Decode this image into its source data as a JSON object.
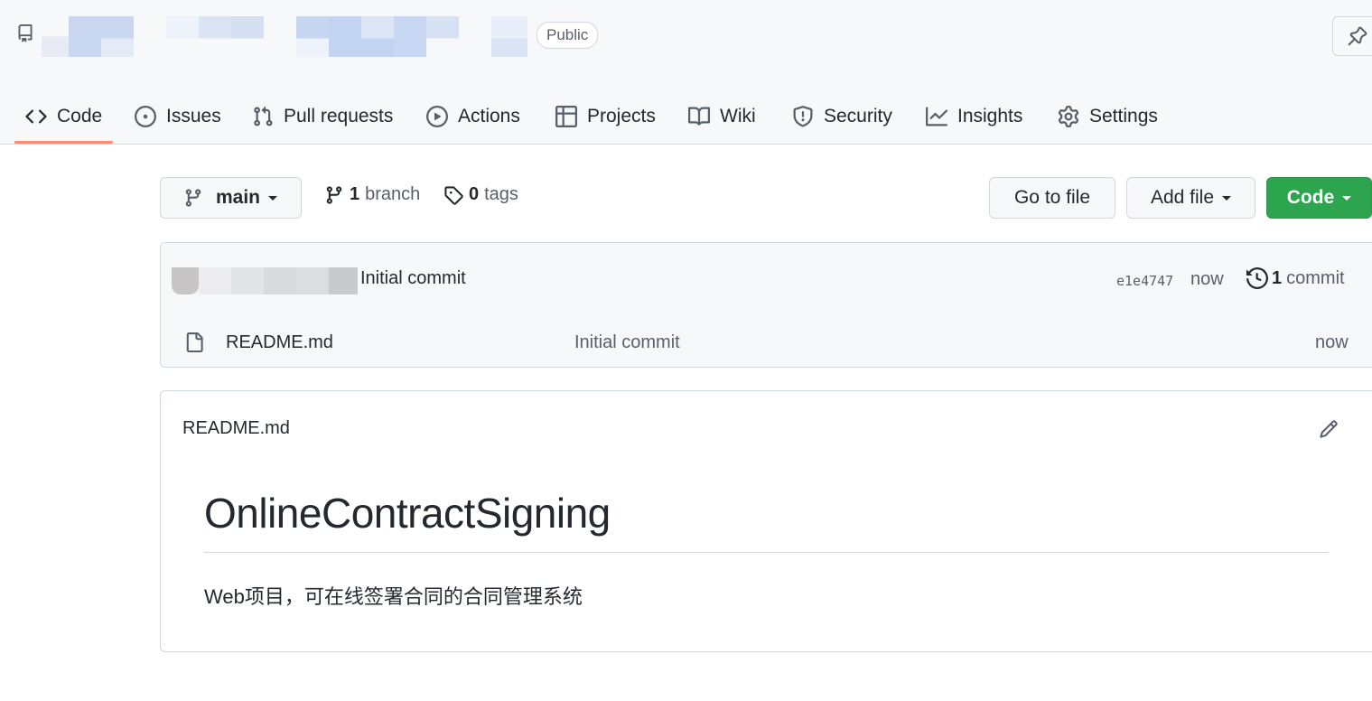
{
  "header": {
    "visibility_badge": "Public"
  },
  "nav": {
    "tabs": [
      {
        "label": "Code",
        "icon": "code-icon"
      },
      {
        "label": "Issues",
        "icon": "issue-opened-icon"
      },
      {
        "label": "Pull requests",
        "icon": "git-pull-request-icon"
      },
      {
        "label": "Actions",
        "icon": "play-icon"
      },
      {
        "label": "Projects",
        "icon": "table-icon"
      },
      {
        "label": "Wiki",
        "icon": "book-icon"
      },
      {
        "label": "Security",
        "icon": "shield-icon"
      },
      {
        "label": "Insights",
        "icon": "graph-icon"
      },
      {
        "label": "Settings",
        "icon": "gear-icon"
      }
    ],
    "active_tab": "Code",
    "accent_color": "#fd8c73"
  },
  "toolbar": {
    "branch_name": "main",
    "branch_count": "1",
    "branch_label": "branch",
    "tag_count": "0",
    "tag_label": "tags",
    "go_to_file": "Go to file",
    "add_file": "Add file",
    "code": "Code",
    "code_button_color": "#2da44e"
  },
  "latest_commit": {
    "message": "Initial commit",
    "sha": "e1e4747",
    "time": "now",
    "count": "1",
    "count_label": "commit"
  },
  "files": [
    {
      "name": "README.md",
      "commit_message": "Initial commit",
      "time": "now",
      "icon": "file-icon"
    }
  ],
  "readme": {
    "filename": "README.md",
    "heading": "OnlineContractSigning",
    "body": "Web项目，可在线签署合同的合同管理系统"
  }
}
